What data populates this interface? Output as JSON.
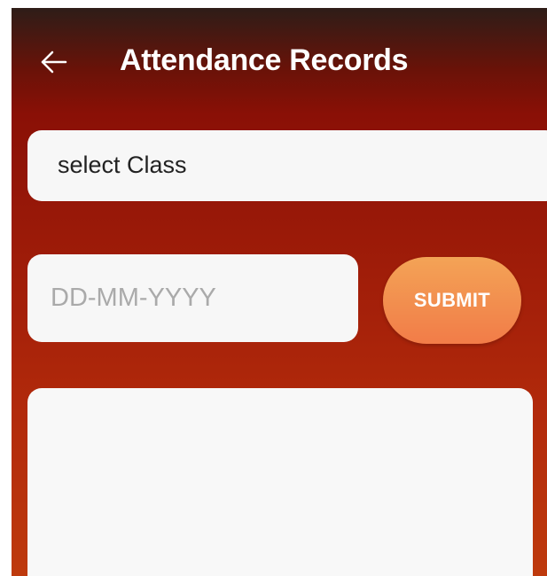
{
  "app_bar": {
    "title": "Attendance Records",
    "back_icon": "arrow-left-icon"
  },
  "class_select": {
    "value": "select Class"
  },
  "date_input": {
    "placeholder": "DD-MM-YYYY",
    "value": ""
  },
  "submit_button": {
    "label": "SUBMIT"
  },
  "colors": {
    "background_top": "#2e1d18",
    "background_mid": "#8a1006",
    "background_bottom": "#be3a0d",
    "field_bg": "#f7f7f7",
    "button_gradient_top": "#f3a356",
    "button_gradient_bottom": "#f27c48"
  }
}
